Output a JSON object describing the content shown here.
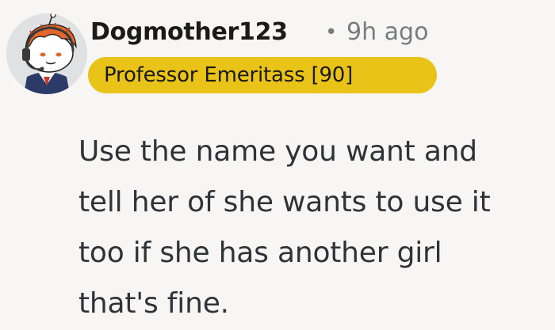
{
  "comment": {
    "author": "Dogmother123",
    "separator": "•",
    "time_ago": "9h ago",
    "flair": "Professor Emeritass [90]",
    "body_lines": [
      "Use the name you want and",
      "tell her of she wants to use it",
      "too if she has another girl",
      "that's fine."
    ]
  },
  "colors": {
    "background": "#f7f6f4",
    "flair_background": "#eac319",
    "author_text": "#1a1a1b",
    "meta_text": "#787c7e",
    "body_text": "#2f3337"
  },
  "icons": {
    "avatar": "snoo-avatar-orange-hair-headset"
  }
}
